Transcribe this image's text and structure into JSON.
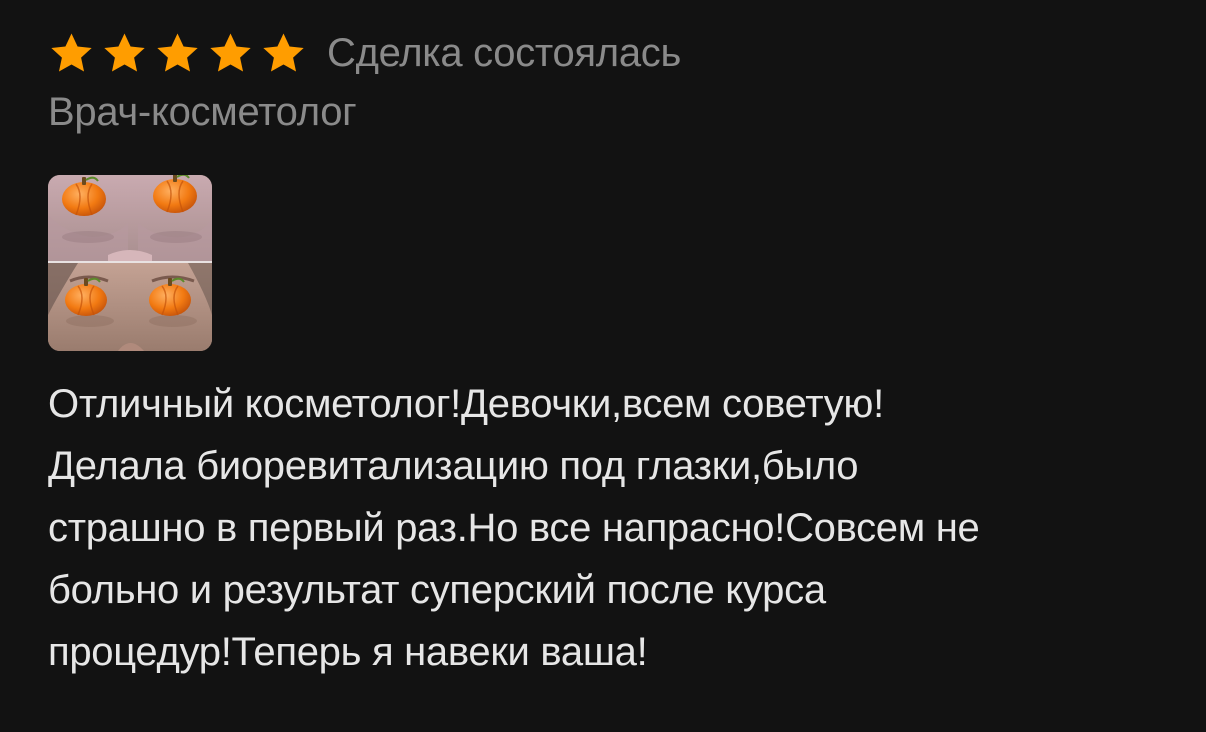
{
  "review": {
    "rating": 5,
    "rating_max": 5,
    "deal_status": "Сделка состоялась",
    "specialty": "Врач-косметолог",
    "photo": {
      "icon": "before-after-photo",
      "overlay_icon": "pumpkin-icon"
    },
    "text": "Отличный косметолог!Девочки,всем советую!\nДелала биоревитализацию под глазки,было\nстрашно в первый раз.Но все напрасно!Совсем не\nбольно и результат суперский после курса\nпроцедур!Теперь я навеки ваша!"
  },
  "colors": {
    "background": "#121212",
    "star": "#ff9d00",
    "muted_text": "#8a8a8a",
    "body_text": "#e6e6e6"
  }
}
